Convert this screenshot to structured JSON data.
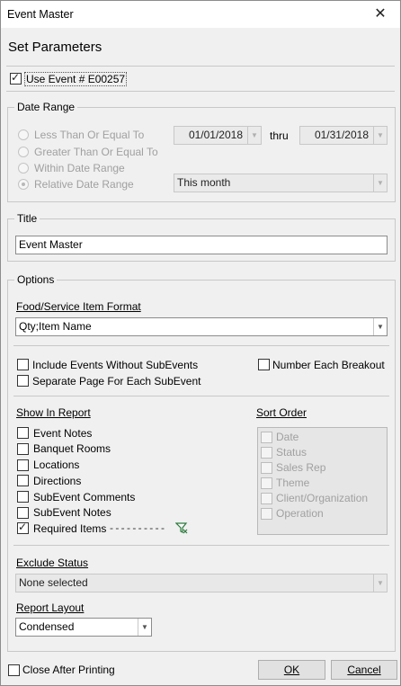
{
  "window": {
    "title": "Event Master",
    "close_glyph": "✕"
  },
  "heading": "Set Parameters",
  "use_event": {
    "label": "Use Event # E00257",
    "checked": true
  },
  "date_range": {
    "group_title": "Date Range",
    "options": [
      {
        "label": "Less Than Or Equal To",
        "selected": false
      },
      {
        "label": "Greater Than Or Equal To",
        "selected": false
      },
      {
        "label": "Within Date Range",
        "selected": false
      },
      {
        "label": "Relative Date Range",
        "selected": true
      }
    ],
    "from_date": "01/01/2018",
    "thru_label": "thru",
    "to_date": "01/31/2018",
    "relative_value": "This month"
  },
  "title_group": {
    "group_title": "Title",
    "value": "Event Master"
  },
  "options": {
    "group_title": "Options",
    "food_format_label": "Food/Service Item Format",
    "food_format_value": "Qty;Item Name",
    "include_without_subevents": {
      "label": "Include Events Without SubEvents",
      "checked": false
    },
    "number_each_breakout": {
      "label": "Number Each Breakout",
      "checked": false
    },
    "separate_page": {
      "label": "Separate Page For Each SubEvent",
      "checked": false
    },
    "show_in_report_label": "Show In Report",
    "show_items": [
      {
        "label": "Event Notes",
        "checked": false
      },
      {
        "label": "Banquet Rooms",
        "checked": false
      },
      {
        "label": "Locations",
        "checked": false
      },
      {
        "label": "Directions",
        "checked": false
      },
      {
        "label": "SubEvent Comments",
        "checked": false
      },
      {
        "label": "SubEvent Notes",
        "checked": false
      },
      {
        "label": "Required Items",
        "checked": true
      }
    ],
    "dashes": "- - - - - - - - - -",
    "sort_order_label": "Sort Order",
    "sort_items": [
      "Date",
      "Status",
      "Sales Rep",
      "Theme",
      "Client/Organization",
      "Operation"
    ],
    "exclude_status_label": "Exclude Status",
    "exclude_status_value": "None selected",
    "report_layout_label": "Report Layout",
    "report_layout_value": "Condensed"
  },
  "footer": {
    "close_after_printing": {
      "label": "Close After Printing",
      "checked": false
    },
    "ok_label": "OK",
    "cancel_label": "Cancel"
  },
  "icons": {
    "filter": "filter-icon",
    "dropdown": "chevron-down-icon"
  }
}
